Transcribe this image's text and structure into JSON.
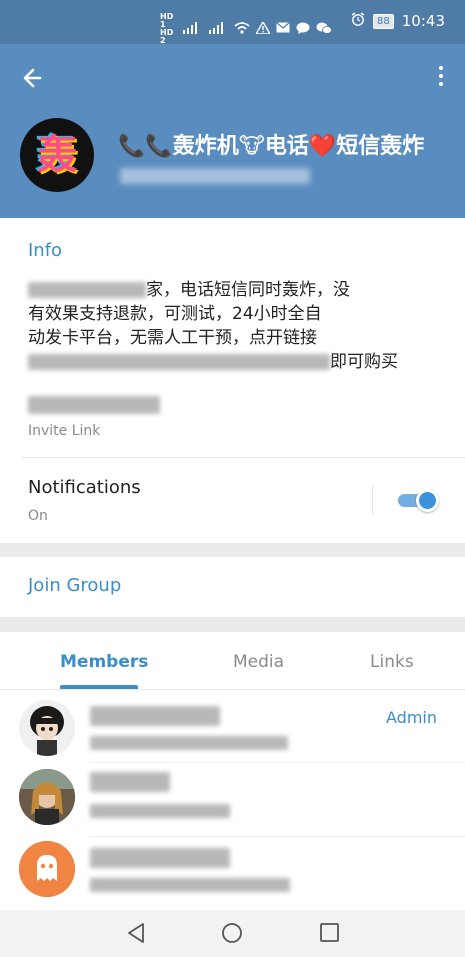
{
  "status_bar": {
    "hd1": "HD 1",
    "hd2": "HD 2",
    "battery": "88",
    "time": "10:43"
  },
  "header": {
    "title": "📞📞轰炸机🐮电话❤️短信轰炸"
  },
  "info": {
    "section_label": "Info",
    "description_line1_tail": "家，电话短信同时轰炸，没",
    "description_line2": "有效果支持退款，可测试，24小时全自",
    "description_line3": "动发卡平台，无需人工干预，点开链接",
    "description_line4_tail": "即可购买",
    "invite_label": "Invite Link",
    "notifications_label": "Notifications",
    "notifications_value": "On",
    "notifications_enabled": true
  },
  "join": {
    "label": "Join Group"
  },
  "tabs": [
    {
      "label": "Members"
    },
    {
      "label": "Media"
    },
    {
      "label": "Links"
    }
  ],
  "members": [
    {
      "badge": "Admin"
    },
    {
      "badge": ""
    },
    {
      "badge": ""
    }
  ],
  "colors": {
    "header": "#5a8dbf",
    "accent": "#3a8ec9"
  }
}
